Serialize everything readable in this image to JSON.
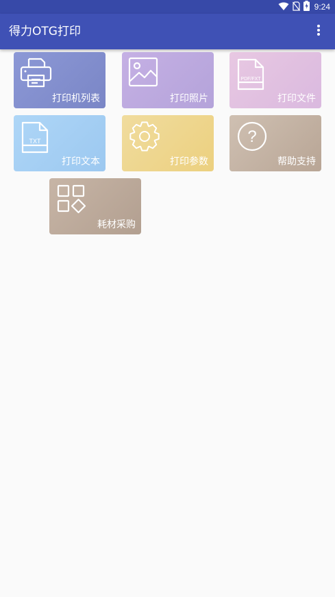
{
  "status_bar": {
    "time": "9:24",
    "icons": [
      "wifi-icon",
      "no-sim-icon",
      "battery-charging-icon"
    ]
  },
  "app_bar": {
    "title": "得力OTG打印",
    "menu_icon": "more-vert-icon"
  },
  "colors": {
    "status_bar": "#3749a8",
    "app_bar": "#3f51b5",
    "background": "#fafafa"
  },
  "tiles": [
    {
      "label": "打印机列表",
      "icon": "printer-icon",
      "colors": [
        "#8c98d6",
        "#7a86c6"
      ]
    },
    {
      "label": "打印照片",
      "icon": "image-icon",
      "colors": [
        "#c5b0e4",
        "#b4a3da"
      ]
    },
    {
      "label": "打印文件",
      "icon": "pdf-file-icon",
      "icon_text": "PDF/FXT",
      "colors": [
        "#e8c8e2",
        "#dab9df"
      ]
    },
    {
      "label": "打印文本",
      "icon": "txt-file-icon",
      "icon_text": "TXT",
      "colors": [
        "#aed6f7",
        "#9cc8f0"
      ]
    },
    {
      "label": "打印参数",
      "icon": "gear-icon",
      "colors": [
        "#f0dc9e",
        "#ecd07f"
      ]
    },
    {
      "label": "帮助支持",
      "icon": "help-icon",
      "icon_text": "?",
      "colors": [
        "#cfc0b2",
        "#b8a595"
      ]
    },
    {
      "label": "耗材采购",
      "icon": "apps-icon",
      "colors": [
        "#c7b5a6",
        "#b29f90"
      ]
    }
  ]
}
